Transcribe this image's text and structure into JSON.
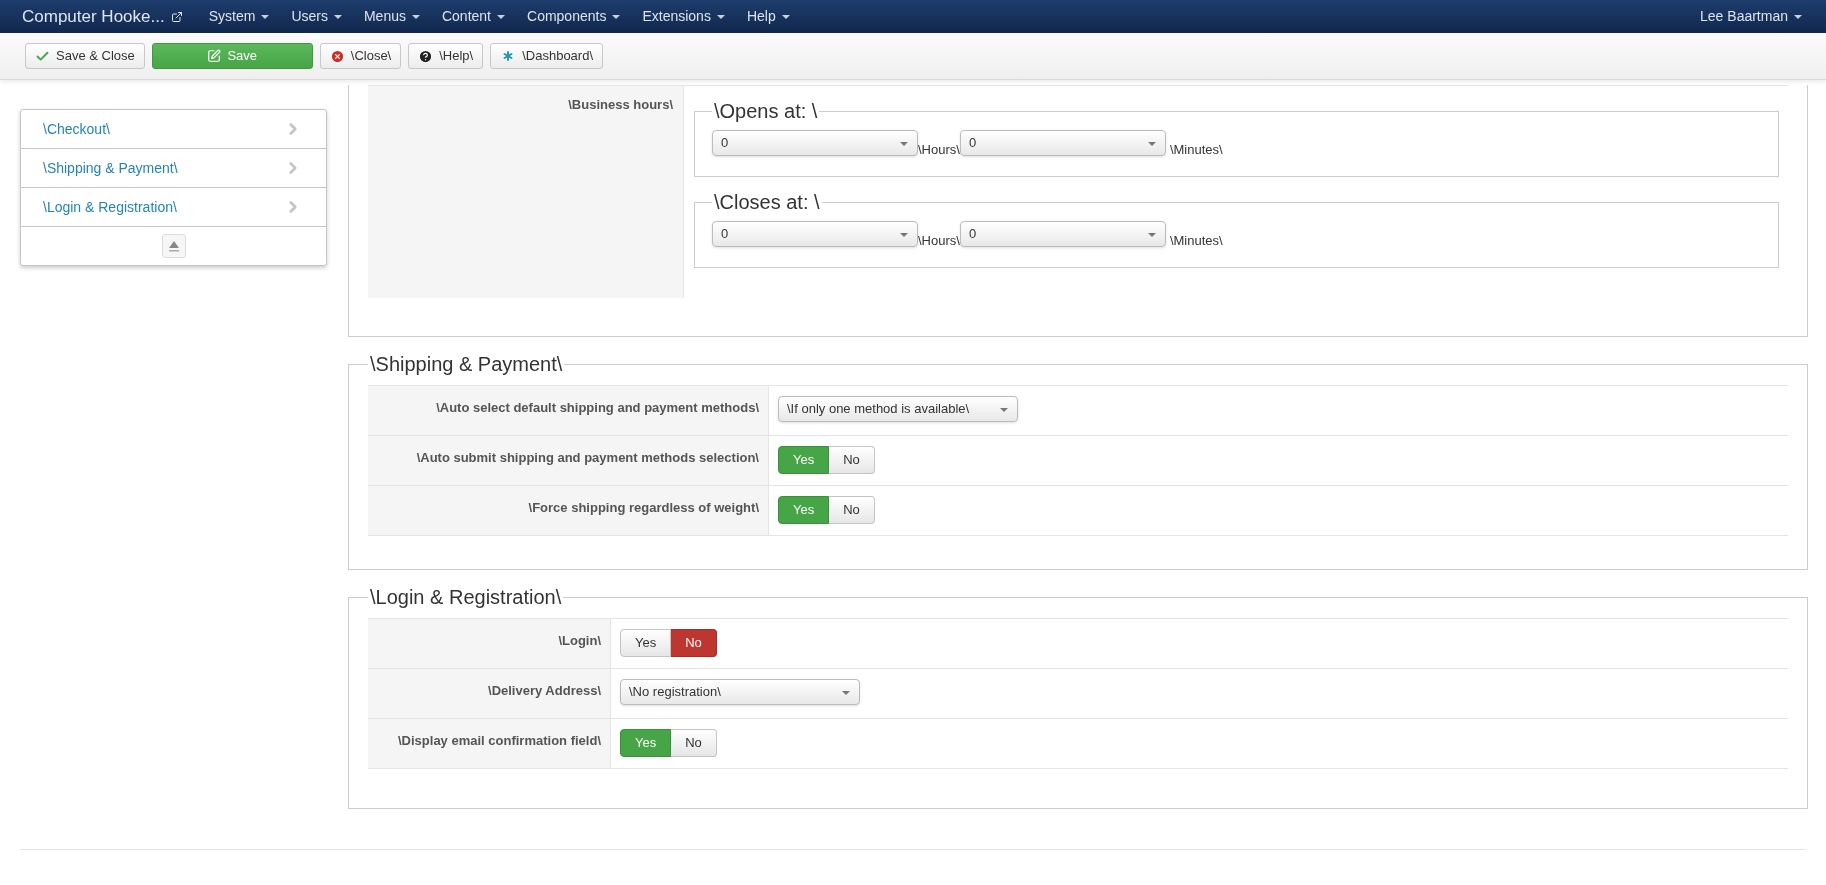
{
  "navbar": {
    "brand": "Computer Hooke...",
    "menus": [
      "System",
      "Users",
      "Menus",
      "Content",
      "Components",
      "Extensions",
      "Help"
    ],
    "user": "Lee Baartman"
  },
  "toolbar": [
    {
      "label": "Save & Close",
      "kind": "save-close"
    },
    {
      "label": "Save",
      "kind": "save"
    },
    {
      "label": "\\Close\\",
      "kind": "close"
    },
    {
      "label": "\\Help\\",
      "kind": "help"
    },
    {
      "label": "\\Dashboard\\",
      "kind": "dashboard"
    }
  ],
  "sidebar": {
    "items": [
      {
        "label": "\\Checkout\\"
      },
      {
        "label": "\\Shipping & Payment\\"
      },
      {
        "label": "\\Login & Registration\\"
      }
    ]
  },
  "business_hours": {
    "label": "\\Business hours\\",
    "groups": [
      {
        "legend": "\\Opens at: \\",
        "fields": [
          {
            "value": "0",
            "unit": "\\Hours\\"
          },
          {
            "value": "0",
            "unit": "\\Minutes\\"
          }
        ]
      },
      {
        "legend": "\\Closes at: \\",
        "fields": [
          {
            "value": "0",
            "unit": "\\Hours\\"
          },
          {
            "value": "0",
            "unit": "\\Minutes\\"
          }
        ]
      }
    ]
  },
  "sections": [
    {
      "legend": "\\Shipping & Payment\\",
      "rows": [
        {
          "label": "\\Auto select default shipping and payment methods\\",
          "kind": "select",
          "value": "\\If only one method is available\\"
        },
        {
          "label": "\\Auto submit shipping and payment methods selection\\",
          "kind": "toggle",
          "options": [
            {
              "label": "Yes",
              "selected": true
            },
            {
              "label": "No",
              "selected": false
            }
          ]
        },
        {
          "label": "\\Force shipping regardless of weight\\",
          "kind": "toggle",
          "options": [
            {
              "label": "Yes",
              "selected": true
            },
            {
              "label": "No",
              "selected": false
            }
          ]
        }
      ]
    },
    {
      "legend": "\\Login & Registration\\",
      "rows": [
        {
          "label": "\\Login\\",
          "kind": "toggle",
          "options": [
            {
              "label": "Yes",
              "selected": false
            },
            {
              "label": "No",
              "selected": true
            }
          ]
        },
        {
          "label": "\\Delivery Address\\",
          "kind": "select",
          "value": "\\No registration\\"
        },
        {
          "label": "\\Display email confirmation field\\",
          "kind": "toggle",
          "options": [
            {
              "label": "Yes",
              "selected": true
            },
            {
              "label": "No",
              "selected": false
            }
          ]
        }
      ]
    }
  ]
}
